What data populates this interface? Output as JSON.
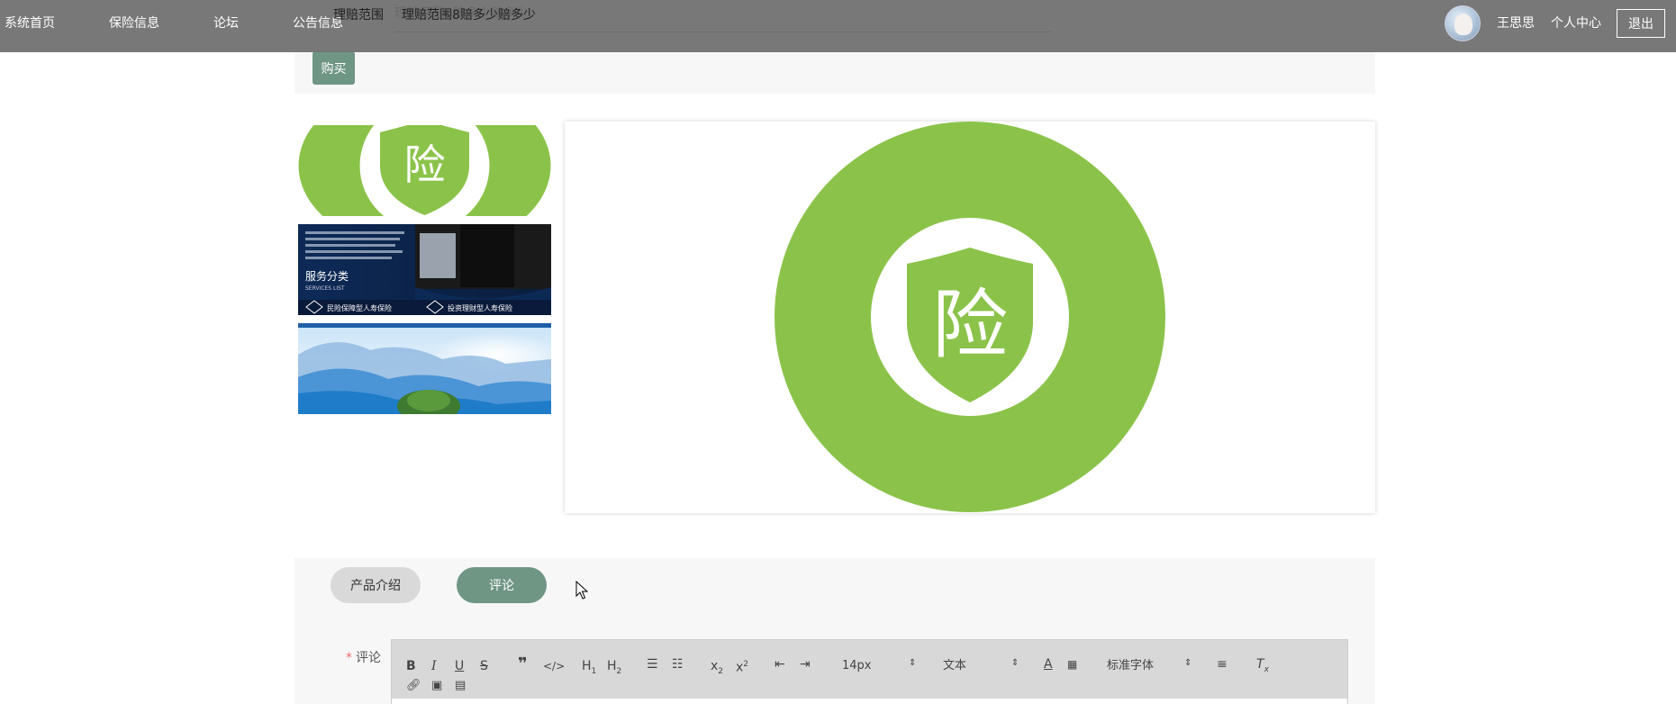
{
  "nav": {
    "items": [
      "系统首页",
      "保险信息",
      "论坛",
      "公告信息"
    ],
    "username": "王思思",
    "personal_center": "个人中心",
    "logout": "退出"
  },
  "detail": {
    "claim_label": "理赔范围",
    "claim_value": "理赔范围8赔多少赔多少",
    "buy_label": "购买"
  },
  "gallery": {
    "badge_char": "险",
    "thumb2": {
      "title": "服务分类",
      "subtitle": "SERVICES LIST",
      "item1": "民险保障型人寿保险",
      "item2": "投资理财型人寿保险"
    }
  },
  "tabs": {
    "intro": "产品介绍",
    "comment": "评论"
  },
  "comment": {
    "label": "评论",
    "required_mark": "*"
  },
  "toolbar": {
    "font_size": "14px",
    "header_type": "文本",
    "font_family": "标准字体"
  },
  "colors": {
    "nav_bg": "#6e6e6e",
    "accent": "#6f9585",
    "badge_green": "#8bc34a"
  }
}
